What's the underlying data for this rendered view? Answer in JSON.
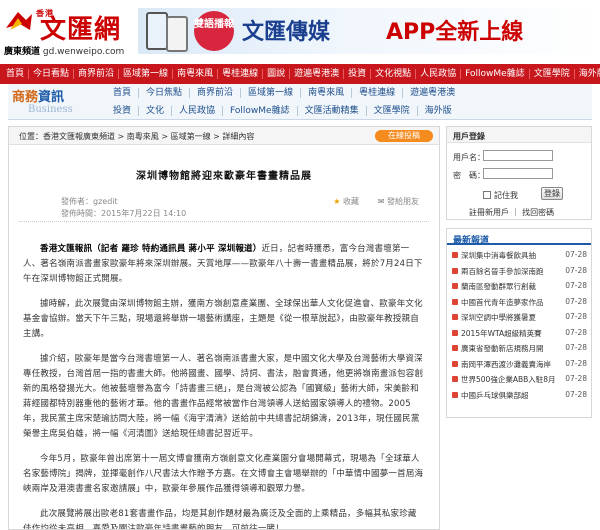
{
  "site": {
    "logo_text": "文匯網",
    "logo_hk": "香港",
    "channel": "廣東頻道",
    "domain": "gd.wenweipo.com"
  },
  "banner": {
    "badge": "雙語播報",
    "brand": "文匯傳媒",
    "app_text": "APP全新上線"
  },
  "main_nav": [
    "首頁",
    "今日看點",
    "商界前沿",
    "區域第一線",
    "南粵來風",
    "粵桂連線",
    "圖說",
    "遊遍粵港澳",
    "投資",
    "文化視點",
    "人民政協",
    "FollowMe雜誌",
    "文匯學院",
    "海外版"
  ],
  "biz_header": {
    "title_a": "商務",
    "title_b": "資訊",
    "subtitle": "Business"
  },
  "biz_nav_row1": [
    "首頁",
    "今日焦點",
    "商界前沿",
    "區域第一線",
    "南粵來風",
    "粵桂連線",
    "遊遍粵港澳"
  ],
  "biz_nav_row2": [
    "投資",
    "文化",
    "人民政協",
    "FollowMe雜誌",
    "文匯活動精集",
    "文匯學院",
    "海外版"
  ],
  "breadcrumb": "位置：香港文匯報廣東頻道 > 南粵來風 > 區域第一線 > 詳細內容",
  "submit_label": "在線投稿",
  "article": {
    "title": "深圳博物館將迎來歐豪年書畫精品展",
    "source": "發佈者：gzedit",
    "time": "發佈時間：2015年7月22日 14:10",
    "fav": "收藏",
    "share": "發給朋友",
    "p1_lead": "香港文匯報訊（記者 羅珍 特約通訊員 蔣小平 深圳報道）",
    "p1": "近日，記者時獲悉，富今台灣書壇第一人、著名嶺南派書畫家歐豪年將來深圳辦展。天賞地厚——歐豪年八十壽一書畫精品展，將於7月24日下午在深圳博物館正式開展。",
    "p2": "據時解，此次展覽由深圳博物館主辦，獲南方嶺創意產業團、全球保出華人文化促進會、歐豪年文化基金會協辦。當天下午三點，現場還將舉辦一場藝術講座，主題是《從一根草說起》，由歐豪年教授親自主講。",
    "p3": "據介紹，歐豪年是當今台灣書壇第一人、著名嶺南派書畫大家，是中國文化大學及台灣藝術大學資深專任教授，台灣首屆一指的書畫大師。他將國畫、國學、詩詞、書法，融會貫通，他更將嶺南畫派包容創新的風格發揚光大。他被藝壇譽為富今「詩書畫三絕」，是台灣被公認為「國寶級」藝術大師，宋美齡和蔣經國都特別器重他的藝術才華。他的書畫作品經常被當作台灣領導人送給國家領導人的禮物。2005年，我民黨主席宋楚瑜訪問大陸，將一幅《海宇清濤》送給前中共總書記胡錦濤，2013年，現任國民黨榮譽主席吳伯雄，將一幅《河清圖》送給現任總書記習近平。",
    "p4": "今年5月，歐豪年曾出席第十一屆文博會獲南方嶺創意文化產業園分會場開幕式，現場為「全球華人名家藝博院」揭牌，並揮毫創作八尺書法大作贈予方嘉。在文博會主會場舉辦的「中華情中國夢一首屆海峽兩岸及港澳書畫名家邀請展」中，歐豪年參展作品獲得領導和觀眾力譽。",
    "p5": "此次展覽將展出歐老81套書畫作品，均是其創作題材最為廣泛及全面的上乘精品，多幅其私家珍藏佳作均從未亮相。喜愛及關注歐豪年詩書畫藝的朋友，可前往一睹！"
  },
  "login": {
    "title": "用戶登錄",
    "username_label": "用戶名：",
    "password_label": "密　碼：",
    "remember_label": "記住我",
    "login_button": "登錄",
    "links": "註冊新用戶 ｜ 找回密碼"
  },
  "latest": {
    "title": "最新報道",
    "items": [
      {
        "text": "深圳集中消毒餐飲具抽",
        "date": "07-28"
      },
      {
        "text": "兩百餘名晉手參加深南跑",
        "date": "07-28"
      },
      {
        "text": "蘭南區發動群眾行創裁",
        "date": "07-28"
      },
      {
        "text": "中國首代青年造夢家作品",
        "date": "07-28"
      },
      {
        "text": "深圳空調中學將獲暑夏",
        "date": "07-28"
      },
      {
        "text": "2015年WTA超級精英賽",
        "date": "07-28"
      },
      {
        "text": "廣東省發動新店規務月開",
        "date": "07-28"
      },
      {
        "text": "南岡平潭西渡沙灘義賣海岸",
        "date": "07-28"
      },
      {
        "text": "世界500強企業ABB入駐8月",
        "date": "07-28"
      },
      {
        "text": "中國乒乓球俱樂部超",
        "date": "07-28"
      }
    ]
  }
}
